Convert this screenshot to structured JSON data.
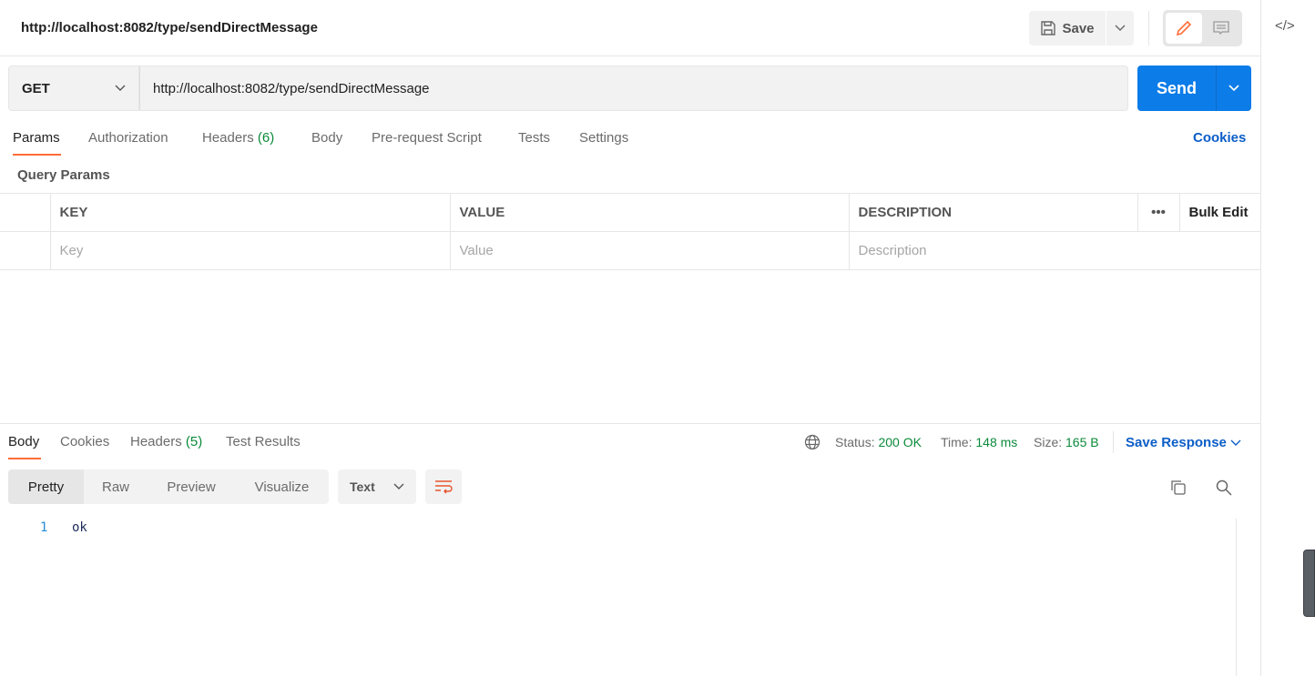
{
  "header": {
    "title": "http://localhost:8082/type/sendDirectMessage",
    "save_label": "Save"
  },
  "request": {
    "method": "GET",
    "url": "http://localhost:8082/type/sendDirectMessage",
    "send_label": "Send"
  },
  "tabs": [
    {
      "label": "Params",
      "active": true
    },
    {
      "label": "Authorization"
    },
    {
      "label": "Headers",
      "count": "(6)"
    },
    {
      "label": "Body"
    },
    {
      "label": "Pre-request Script"
    },
    {
      "label": "Tests"
    },
    {
      "label": "Settings"
    }
  ],
  "cookies_link": "Cookies",
  "query_params": {
    "title": "Query Params",
    "columns": [
      "KEY",
      "VALUE",
      "DESCRIPTION"
    ],
    "bulk_edit": "Bulk Edit",
    "placeholders": {
      "key": "Key",
      "value": "Value",
      "description": "Description"
    }
  },
  "response": {
    "tabs": [
      {
        "label": "Body",
        "active": true
      },
      {
        "label": "Cookies"
      },
      {
        "label": "Headers",
        "count": "(5)"
      },
      {
        "label": "Test Results"
      }
    ],
    "status_label": "Status:",
    "status": "200 OK",
    "time_label": "Time:",
    "time": "148 ms",
    "size_label": "Size:",
    "size": "165 B",
    "save_response": "Save Response",
    "views": [
      "Pretty",
      "Raw",
      "Preview",
      "Visualize"
    ],
    "format": "Text",
    "lines": [
      {
        "num": "1",
        "text": "ok"
      }
    ]
  },
  "colors": {
    "accent": "#ff6c37",
    "send": "#0c7ce8",
    "link": "#0b5ec7",
    "success": "#0a8a3a"
  }
}
